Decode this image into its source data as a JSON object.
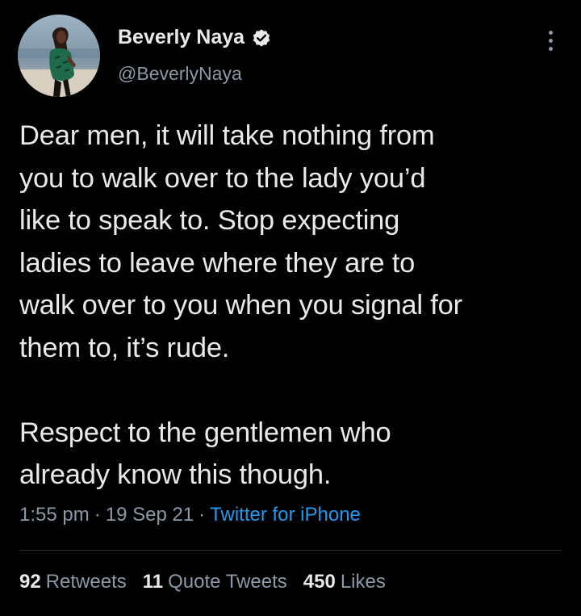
{
  "author": {
    "display_name": "Beverly Naya",
    "handle": "@BeverlyNaya",
    "verified": true,
    "avatar_icon": "profile-photo"
  },
  "tweet": {
    "paragraph_1": "Dear men, it will take nothing from\nyou to walk over to the lady you’d\nlike to speak to. Stop expecting\nladies to leave where they are to\nwalk over to you when you signal for\nthem to, it’s rude.",
    "paragraph_2": "Respect to the gentlemen who\nalready know this though."
  },
  "meta": {
    "time": "1:55 pm",
    "separator": "·",
    "date": "19 Sep 21",
    "source": "Twitter for iPhone"
  },
  "stats": {
    "retweets_count": "92",
    "retweets_label": "Retweets",
    "quotes_count": "11",
    "quotes_label": "Quote Tweets",
    "likes_count": "450",
    "likes_label": "Likes"
  },
  "colors": {
    "background": "#000000",
    "text": "#e7e9ea",
    "secondary": "#8b98a5",
    "link": "#1d9bf0",
    "divider": "#2f3336"
  }
}
